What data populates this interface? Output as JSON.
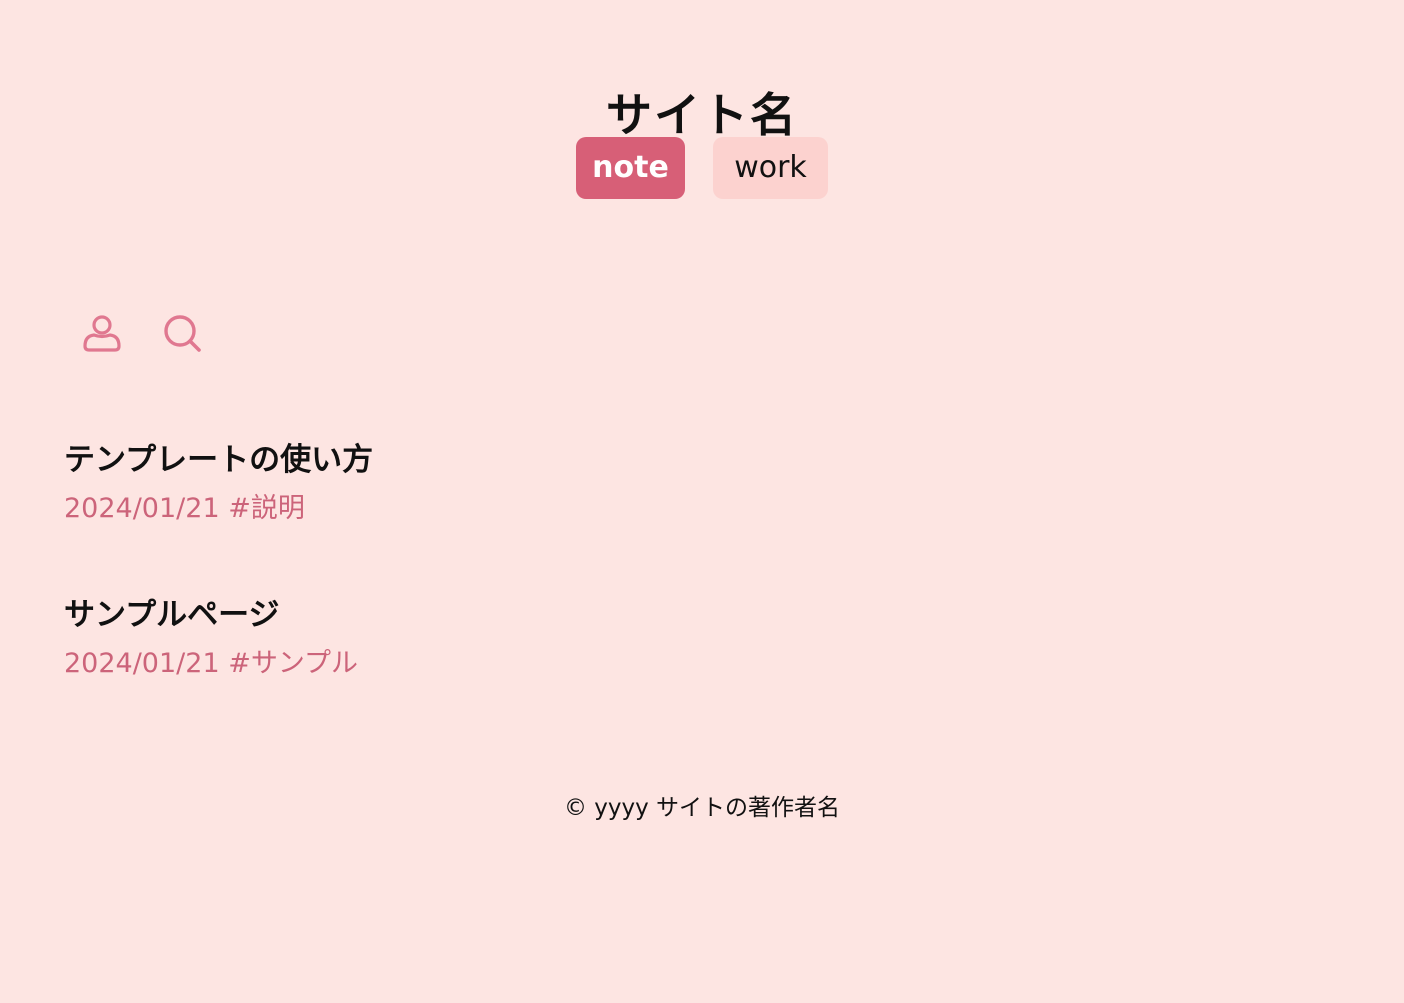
{
  "site": {
    "title": "サイト名"
  },
  "tabs": [
    {
      "label": "note",
      "active": true
    },
    {
      "label": "work",
      "active": false
    }
  ],
  "toolbar": {
    "icons": [
      "user-icon",
      "search-icon"
    ]
  },
  "posts": [
    {
      "title": "テンプレートの使い方",
      "date": "2024/01/21",
      "tag": "#説明"
    },
    {
      "title": "サンプルページ",
      "date": "2024/01/21",
      "tag": "#サンプル"
    }
  ],
  "footer": {
    "copyright": "© yyyy サイトの著作者名"
  },
  "colors": {
    "background": "#fde5e2",
    "accent": "#d75f77",
    "tab_inactive": "#fcd2cf",
    "meta_text": "#cc647a",
    "icon": "#e07890"
  }
}
